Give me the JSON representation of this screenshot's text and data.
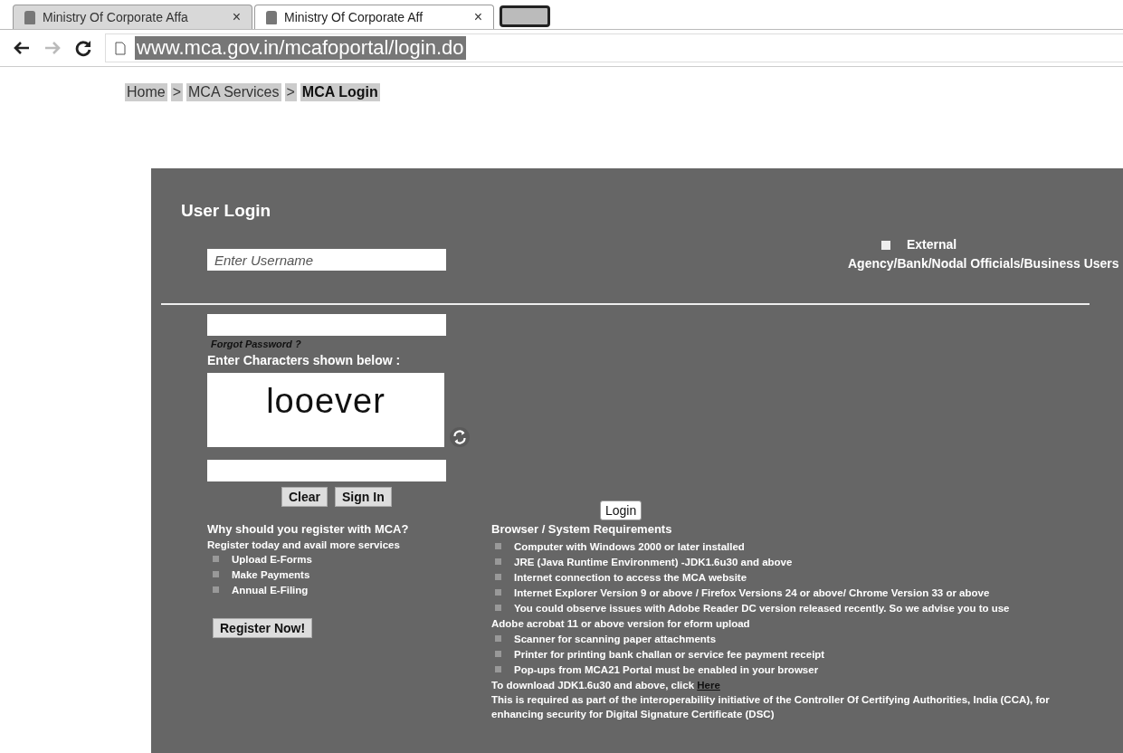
{
  "browser": {
    "tabs": [
      {
        "title": "Ministry Of Corporate Affa",
        "selected": false
      },
      {
        "title": "Ministry Of Corporate Aff",
        "selected": true
      }
    ],
    "close_label": "×",
    "url": "www.mca.gov.in/mcafoportal/login.do",
    "forward_disabled": true
  },
  "breadcrumb": [
    {
      "label": "Home",
      "current": false
    },
    {
      "label": "MCA Services",
      "current": false
    },
    {
      "label": "MCA Login",
      "current": true
    }
  ],
  "breadcrumb_separator": ">",
  "login": {
    "title": "User Login",
    "username_placeholder": "Enter Username",
    "external": {
      "label": "External",
      "label_continued": "Agency/Bank/Nodal Officials/Business Users",
      "checked": false
    },
    "forgot_password": "Forgot Password ?",
    "captcha_prompt": "Enter Characters shown below :",
    "captcha_text": "looever",
    "buttons": [
      "Clear",
      "Sign In"
    ],
    "tooltip": "Login"
  },
  "register": {
    "heading": "Why should you register with MCA?",
    "intro": "Register today and avail more services",
    "items": [
      "Upload E-Forms",
      "Make Payments",
      "Annual E-Filing"
    ],
    "button": "Register Now!"
  },
  "requirements": {
    "heading": "Browser / System Requirements",
    "items": [
      {
        "kind": "bullet",
        "text": "Computer with Windows 2000 or later installed"
      },
      {
        "kind": "bullet",
        "text": "JRE (Java Runtime Environment) -JDK1.6u30 and above"
      },
      {
        "kind": "bullet",
        "text": "Internet connection to access the MCA website"
      },
      {
        "kind": "bullet",
        "text": "Internet Explorer Version 9 or above / Firefox Versions 24 or above/ Chrome Version 33 or above"
      },
      {
        "kind": "bullet",
        "text": "You could observe issues with Adobe Reader DC version released recently. So we advise you to use"
      },
      {
        "kind": "plain",
        "text": "Adobe acrobat 11 or above version for eform upload"
      },
      {
        "kind": "bullet",
        "text": "Scanner for scanning paper attachments"
      },
      {
        "kind": "bullet",
        "text": "Printer for printing bank challan or service fee payment receipt"
      },
      {
        "kind": "bullet",
        "text": "Pop-ups from MCA21 Portal must be enabled in your browser"
      }
    ],
    "download_text": "To download JDK1.6u30 and above, click ",
    "download_link": "Here",
    "note": "This is required as part of the interoperability initiative of the Controller Of Certifying Authorities, India (CCA), for enhancing security for Digital Signature Certificate (DSC)"
  }
}
